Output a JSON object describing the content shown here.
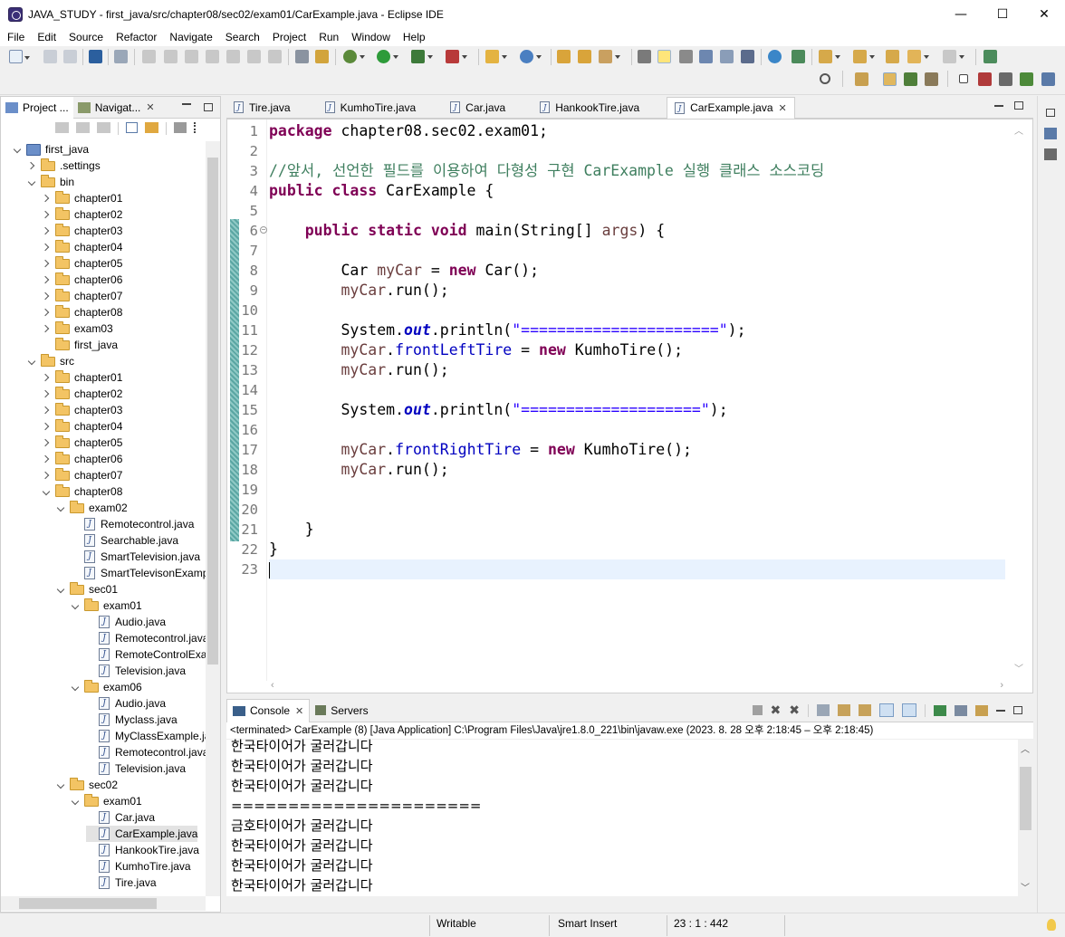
{
  "window": {
    "title": "JAVA_STUDY - first_java/src/chapter08/sec02/exam01/CarExample.java - Eclipse IDE",
    "minimize": "—",
    "maximize": "☐",
    "close": "✕"
  },
  "menu": [
    "File",
    "Edit",
    "Source",
    "Refactor",
    "Navigate",
    "Search",
    "Project",
    "Run",
    "Window",
    "Help"
  ],
  "left_tabs": [
    {
      "label": "Project ..."
    },
    {
      "label": "Navigat..."
    }
  ],
  "tree": [
    {
      "label": "first_java",
      "depth": 0,
      "kind": "project",
      "toggle": "open"
    },
    {
      "label": ".settings",
      "depth": 1,
      "kind": "folder",
      "toggle": "closed"
    },
    {
      "label": "bin",
      "depth": 1,
      "kind": "folder",
      "toggle": "open"
    },
    {
      "label": "chapter01",
      "depth": 2,
      "kind": "folder",
      "toggle": "closed"
    },
    {
      "label": "chapter02",
      "depth": 2,
      "kind": "folder",
      "toggle": "closed"
    },
    {
      "label": "chapter03",
      "depth": 2,
      "kind": "folder",
      "toggle": "closed"
    },
    {
      "label": "chapter04",
      "depth": 2,
      "kind": "folder",
      "toggle": "closed"
    },
    {
      "label": "chapter05",
      "depth": 2,
      "kind": "folder",
      "toggle": "closed"
    },
    {
      "label": "chapter06",
      "depth": 2,
      "kind": "folder",
      "toggle": "closed"
    },
    {
      "label": "chapter07",
      "depth": 2,
      "kind": "folder",
      "toggle": "closed"
    },
    {
      "label": "chapter08",
      "depth": 2,
      "kind": "folder",
      "toggle": "closed"
    },
    {
      "label": "exam03",
      "depth": 2,
      "kind": "folder",
      "toggle": "closed"
    },
    {
      "label": "first_java",
      "depth": 2,
      "kind": "folder",
      "toggle": "none"
    },
    {
      "label": "src",
      "depth": 1,
      "kind": "folder",
      "toggle": "open"
    },
    {
      "label": "chapter01",
      "depth": 2,
      "kind": "folder",
      "toggle": "closed"
    },
    {
      "label": "chapter02",
      "depth": 2,
      "kind": "folder",
      "toggle": "closed"
    },
    {
      "label": "chapter03",
      "depth": 2,
      "kind": "folder",
      "toggle": "closed"
    },
    {
      "label": "chapter04",
      "depth": 2,
      "kind": "folder",
      "toggle": "closed"
    },
    {
      "label": "chapter05",
      "depth": 2,
      "kind": "folder",
      "toggle": "closed"
    },
    {
      "label": "chapter06",
      "depth": 2,
      "kind": "folder",
      "toggle": "closed"
    },
    {
      "label": "chapter07",
      "depth": 2,
      "kind": "folder",
      "toggle": "closed"
    },
    {
      "label": "chapter08",
      "depth": 2,
      "kind": "folder",
      "toggle": "open"
    },
    {
      "label": "exam02",
      "depth": 3,
      "kind": "folder",
      "toggle": "open"
    },
    {
      "label": "Remotecontrol.java",
      "depth": 4,
      "kind": "java",
      "toggle": "none"
    },
    {
      "label": "Searchable.java",
      "depth": 4,
      "kind": "java",
      "toggle": "none"
    },
    {
      "label": "SmartTelevision.java",
      "depth": 4,
      "kind": "java",
      "toggle": "none"
    },
    {
      "label": "SmartTelevisonExamp",
      "depth": 4,
      "kind": "java",
      "toggle": "none"
    },
    {
      "label": "sec01",
      "depth": 3,
      "kind": "folder",
      "toggle": "open"
    },
    {
      "label": "exam01",
      "depth": 4,
      "kind": "folder",
      "toggle": "open"
    },
    {
      "label": "Audio.java",
      "depth": 5,
      "kind": "java",
      "toggle": "none"
    },
    {
      "label": "Remotecontrol.java",
      "depth": 5,
      "kind": "java",
      "toggle": "none"
    },
    {
      "label": "RemoteControlExar",
      "depth": 5,
      "kind": "java",
      "toggle": "none"
    },
    {
      "label": "Television.java",
      "depth": 5,
      "kind": "java",
      "toggle": "none"
    },
    {
      "label": "exam06",
      "depth": 4,
      "kind": "folder",
      "toggle": "open"
    },
    {
      "label": "Audio.java",
      "depth": 5,
      "kind": "java",
      "toggle": "none"
    },
    {
      "label": "Myclass.java",
      "depth": 5,
      "kind": "java",
      "toggle": "none"
    },
    {
      "label": "MyClassExample.ja",
      "depth": 5,
      "kind": "java",
      "toggle": "none"
    },
    {
      "label": "Remotecontrol.java",
      "depth": 5,
      "kind": "java",
      "toggle": "none"
    },
    {
      "label": "Television.java",
      "depth": 5,
      "kind": "java",
      "toggle": "none"
    },
    {
      "label": "sec02",
      "depth": 3,
      "kind": "folder",
      "toggle": "open"
    },
    {
      "label": "exam01",
      "depth": 4,
      "kind": "folder",
      "toggle": "open"
    },
    {
      "label": "Car.java",
      "depth": 5,
      "kind": "java",
      "toggle": "none"
    },
    {
      "label": "CarExample.java",
      "depth": 5,
      "kind": "java",
      "toggle": "none",
      "selected": true
    },
    {
      "label": "HankookTire.java",
      "depth": 5,
      "kind": "java",
      "toggle": "none"
    },
    {
      "label": "KumhoTire.java",
      "depth": 5,
      "kind": "java",
      "toggle": "none"
    },
    {
      "label": "Tire.java",
      "depth": 5,
      "kind": "java",
      "toggle": "none"
    }
  ],
  "editor_tabs": [
    {
      "label": "Tire.java",
      "active": false
    },
    {
      "label": "KumhoTire.java",
      "active": false
    },
    {
      "label": "Car.java",
      "active": false
    },
    {
      "label": "HankookTire.java",
      "active": false
    },
    {
      "label": "CarExample.java",
      "active": true
    }
  ],
  "code": [
    [
      {
        "t": "package",
        "c": "kw"
      },
      {
        "t": " chapter08.sec02.exam01;"
      }
    ],
    [],
    [
      {
        "t": "//앞서, 선언한 필드를 이용하여 다형성 구현 CarExample 실행 클래스 소스코딩",
        "c": "cm"
      }
    ],
    [
      {
        "t": "public",
        "c": "kw"
      },
      {
        "t": " "
      },
      {
        "t": "class",
        "c": "kw"
      },
      {
        "t": " CarExample {"
      }
    ],
    [],
    [
      {
        "t": "    "
      },
      {
        "t": "public",
        "c": "kw"
      },
      {
        "t": " "
      },
      {
        "t": "static",
        "c": "kw"
      },
      {
        "t": " "
      },
      {
        "t": "void",
        "c": "kw"
      },
      {
        "t": " main(String[] "
      },
      {
        "t": "args",
        "c": "var"
      },
      {
        "t": ") {"
      }
    ],
    [],
    [
      {
        "t": "        Car "
      },
      {
        "t": "myCar",
        "c": "var"
      },
      {
        "t": " = "
      },
      {
        "t": "new",
        "c": "kw"
      },
      {
        "t": " Car();"
      }
    ],
    [
      {
        "t": "        "
      },
      {
        "t": "myCar",
        "c": "var"
      },
      {
        "t": ".run();"
      }
    ],
    [],
    [
      {
        "t": "        System."
      },
      {
        "t": "out",
        "c": "sfld"
      },
      {
        "t": ".println("
      },
      {
        "t": "\"======================\"",
        "c": "str"
      },
      {
        "t": ");"
      }
    ],
    [
      {
        "t": "        "
      },
      {
        "t": "myCar",
        "c": "var"
      },
      {
        "t": "."
      },
      {
        "t": "frontLeftTire",
        "c": "fld"
      },
      {
        "t": " = "
      },
      {
        "t": "new",
        "c": "kw"
      },
      {
        "t": " KumhoTire();"
      }
    ],
    [
      {
        "t": "        "
      },
      {
        "t": "myCar",
        "c": "var"
      },
      {
        "t": ".run();"
      }
    ],
    [],
    [
      {
        "t": "        System."
      },
      {
        "t": "out",
        "c": "sfld"
      },
      {
        "t": ".println("
      },
      {
        "t": "\"====================\"",
        "c": "str"
      },
      {
        "t": ");"
      }
    ],
    [],
    [
      {
        "t": "        "
      },
      {
        "t": "myCar",
        "c": "var"
      },
      {
        "t": "."
      },
      {
        "t": "frontRightTire",
        "c": "fld"
      },
      {
        "t": " = "
      },
      {
        "t": "new",
        "c": "kw"
      },
      {
        "t": " KumhoTire();"
      }
    ],
    [
      {
        "t": "        "
      },
      {
        "t": "myCar",
        "c": "var"
      },
      {
        "t": ".run();"
      }
    ],
    [],
    [],
    [
      {
        "t": "    }"
      }
    ],
    [
      {
        "t": "}"
      }
    ],
    []
  ],
  "current_line": 23,
  "folding_line": 6,
  "console_tabs": [
    {
      "label": "Console",
      "active": true
    },
    {
      "label": "Servers",
      "active": false
    }
  ],
  "console_desc": "<terminated> CarExample (8) [Java Application] C:\\Program Files\\Java\\jre1.8.0_221\\bin\\javaw.exe  (2023. 8. 28 오후 2:18:45 – 오후 2:18:45)",
  "console_lines": [
    "한국타이어가 굴러갑니다",
    "한국타이어가 굴러갑니다",
    "한국타이어가 굴러갑니다",
    "======================",
    "금호타이어가 굴러갑니다",
    "한국타이어가 굴러갑니다",
    "한국타이어가 굴러갑니다",
    "한국타이어가 굴러갑니다"
  ],
  "status": {
    "writable": "Writable",
    "insert_mode": "Smart Insert",
    "position": "23 : 1 : 442"
  }
}
